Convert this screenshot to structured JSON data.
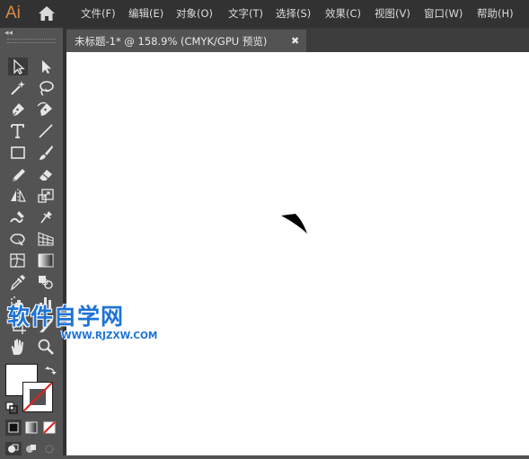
{
  "app": {
    "logo": "Ai"
  },
  "menu": {
    "items": [
      {
        "label": "文件(F)"
      },
      {
        "label": "编辑(E)"
      },
      {
        "label": "对象(O)"
      },
      {
        "label": "文字(T)"
      },
      {
        "label": "选择(S)"
      },
      {
        "label": "效果(C)"
      },
      {
        "label": "视图(V)"
      },
      {
        "label": "窗口(W)"
      },
      {
        "label": "帮助(H)"
      }
    ]
  },
  "toolbox": {
    "collapse_glyph": "◂◂"
  },
  "tabs": [
    {
      "title": "未标题-1* @ 158.9% (CMYK/GPU 预览)",
      "close_glyph": "✖",
      "active": true
    }
  ],
  "watermark": {
    "title": "软件自学网",
    "url": "WWW.RJZXW.COM"
  },
  "colors": {
    "menubar": "#323232",
    "panel": "#535353",
    "canvas": "#ffffff",
    "logo": "#d98c4a",
    "watermark": "#1e73d6",
    "none_slash": "#e02020"
  },
  "icons": [
    "home-icon",
    "selection-tool-icon",
    "direct-selection-tool-icon",
    "magic-wand-tool-icon",
    "lasso-tool-icon",
    "pen-tool-icon",
    "curvature-tool-icon",
    "type-tool-icon",
    "line-segment-tool-icon",
    "rectangle-tool-icon",
    "paintbrush-tool-icon",
    "pencil-tool-icon",
    "eraser-tool-icon",
    "reflect-tool-icon",
    "scale-tool-icon",
    "warp-tool-icon",
    "puppet-warp-tool-icon",
    "free-transform-tool-icon",
    "perspective-grid-tool-icon",
    "mesh-tool-icon",
    "gradient-tool-icon",
    "eyedropper-tool-icon",
    "blend-tool-icon",
    "symbol-sprayer-tool-icon",
    "column-graph-tool-icon",
    "artboard-tool-icon",
    "slice-tool-icon",
    "hand-tool-icon",
    "zoom-tool-icon",
    "fill-swatch",
    "stroke-swatch",
    "swap-fill-stroke-icon",
    "default-fill-stroke-icon",
    "color-mode-icon",
    "gradient-mode-icon",
    "none-mode-icon",
    "draw-normal-icon",
    "draw-behind-icon",
    "draw-inside-icon"
  ]
}
